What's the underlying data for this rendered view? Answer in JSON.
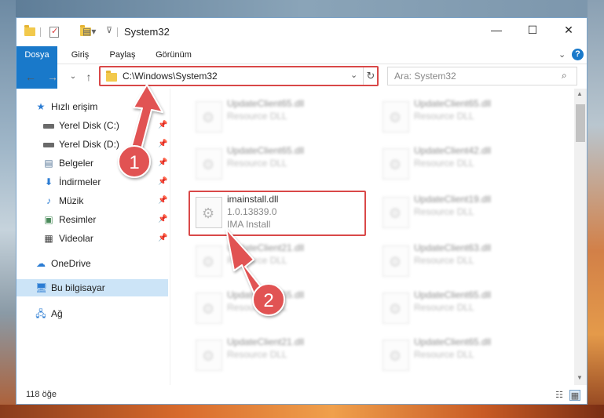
{
  "window": {
    "title": "System32",
    "controls": {
      "minimize": "—",
      "maximize": "☐",
      "close": "✕"
    }
  },
  "ribbon": {
    "tabs": [
      {
        "label": "Dosya"
      },
      {
        "label": "Giriş"
      },
      {
        "label": "Paylaş"
      },
      {
        "label": "Görünüm"
      }
    ],
    "help": "?"
  },
  "navigation": {
    "back": "←",
    "forward": "→",
    "recent": "⌄",
    "up": "↑",
    "address": "C:\\Windows\\System32",
    "refresh": "↻",
    "search_placeholder": "Ara: System32"
  },
  "sidebar": {
    "quick_access": "Hızlı erişim",
    "items": [
      {
        "label": "Yerel Disk (C:)",
        "icon": "drive-icon"
      },
      {
        "label": "Yerel Disk (D:)",
        "icon": "drive-icon"
      },
      {
        "label": "Belgeler",
        "icon": "documents-icon"
      },
      {
        "label": "İndirmeler",
        "icon": "downloads-icon"
      },
      {
        "label": "Müzik",
        "icon": "music-icon"
      },
      {
        "label": "Resimler",
        "icon": "pictures-icon"
      },
      {
        "label": "Videolar",
        "icon": "videos-icon"
      }
    ],
    "onedrive": "OneDrive",
    "this_pc": "Bu bilgisayar",
    "network": "Ağ"
  },
  "files": {
    "highlighted": {
      "name": "imainstall.dll",
      "version": "1.0.13839.0",
      "description": "IMA Install"
    },
    "others": [
      {
        "name": "UpdateClient65.dll",
        "description": "Resource DLL"
      },
      {
        "name": "UpdateClient65.dll",
        "description": "Resource DLL"
      },
      {
        "name": "UpdateClient65.dll",
        "description": "Resource DLL"
      },
      {
        "name": "UpdateClient42.dll",
        "description": "Resource DLL"
      },
      {
        "name": "UpdateClient19.dll",
        "description": "Resource DLL"
      },
      {
        "name": "UpdateClient21.dll",
        "description": "Resource DLL"
      },
      {
        "name": "UpdateClient63.dll",
        "description": "Resource DLL"
      },
      {
        "name": "UpdateClient65.dll",
        "description": "Resource DLL"
      },
      {
        "name": "UpdateClient65.dll",
        "description": "Resource DLL"
      },
      {
        "name": "UpdateClient21.dll",
        "description": "Resource DLL"
      },
      {
        "name": "UpdateClient65.dll",
        "description": "Resource DLL"
      }
    ]
  },
  "status": {
    "item_count": "118 öğe"
  },
  "annotations": {
    "step1": "1",
    "step2": "2",
    "color": "#d94848"
  }
}
